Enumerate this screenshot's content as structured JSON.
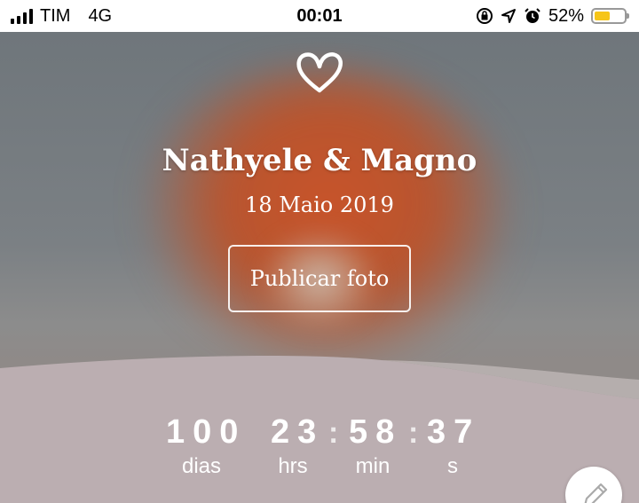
{
  "status_bar": {
    "carrier": "TIM",
    "network": "4G",
    "time": "00:01",
    "battery_percent": "52%",
    "battery_level": 0.52,
    "battery_color": "#f6c518"
  },
  "hero": {
    "icon": "heart-outline-icon",
    "names": "Nathyele & Magno",
    "date": "18 Maio 2019",
    "publish_button": "Publicar foto",
    "band_color": "#bbaeb1"
  },
  "countdown": {
    "days": "100",
    "hours": "23",
    "minutes": "58",
    "seconds": "37",
    "separator": ":",
    "days_label": "dias",
    "hours_label": "hrs",
    "minutes_label": "min",
    "seconds_label": "s"
  },
  "fab": {
    "icon": "pencil-icon"
  }
}
